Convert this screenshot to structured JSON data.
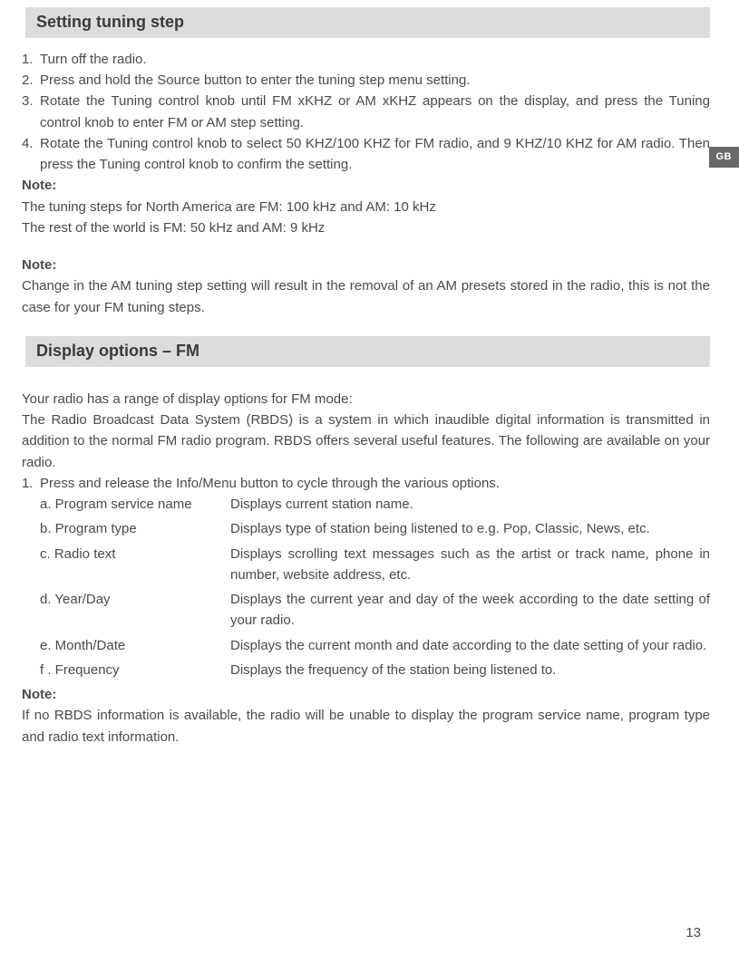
{
  "sideTab": "GB",
  "pageNumber": "13",
  "section1": {
    "heading": "Setting tuning step",
    "steps": [
      {
        "num": "1.",
        "text": "Turn off the radio."
      },
      {
        "num": "2.",
        "text": "Press and hold the Source button to enter the tuning step menu setting."
      },
      {
        "num": "3.",
        "text": "Rotate the Tuning control knob until FM xKHZ or AM xKHZ appears on the display, and press the Tuning control knob to enter FM or AM step setting."
      },
      {
        "num": "4.",
        "text": "Rotate the Tuning control knob to select 50 KHZ/100 KHZ for FM radio, and 9 KHZ/10 KHZ for AM radio. Then press the Tuning control knob to confirm the setting."
      }
    ],
    "note1Label": "Note:",
    "note1Line1": "The tuning steps for North America are FM: 100 kHz and AM: 10 kHz",
    "note1Line2": "The rest of the world is FM: 50 kHz and AM: 9 kHz",
    "note2Label": "Note:",
    "note2Text": "Change in the AM tuning step setting will result in the removal of an AM presets stored in the radio, this is not the case for your FM tuning steps."
  },
  "section2": {
    "heading": "Display options – FM",
    "introLine1": "Your radio has a range of display options for FM mode:",
    "introLine2": "The Radio Broadcast Data System (RBDS) is a system in which inaudible digital information is transmitted in addition to the normal FM radio program. RBDS offers several useful features. The following are available on your radio.",
    "step1": {
      "num": "1.",
      "text": "Press and release the Info/Menu button to cycle through the various options."
    },
    "options": [
      {
        "label": "a. Program service name",
        "desc": "Displays current station name."
      },
      {
        "label": "b. Program type",
        "desc": "Displays type of station being listened to e.g. Pop, Classic, News, etc."
      },
      {
        "label": "c. Radio text",
        "desc": "Displays scrolling text messages such as the artist or track name, phone in number, website address, etc."
      },
      {
        "label": "d. Year/Day",
        "desc": "Displays the current year and day of the week according to the date setting of your radio."
      },
      {
        "label": "e. Month/Date",
        "desc": "Displays the current month and date according to the date setting of your radio."
      },
      {
        "label": "f . Frequency",
        "desc": "Displays the frequency of the station being listened to."
      }
    ],
    "noteLabel": "Note:",
    "noteText": "If no RBDS information is available, the radio will be unable to display the program service name, program type and radio text information."
  }
}
